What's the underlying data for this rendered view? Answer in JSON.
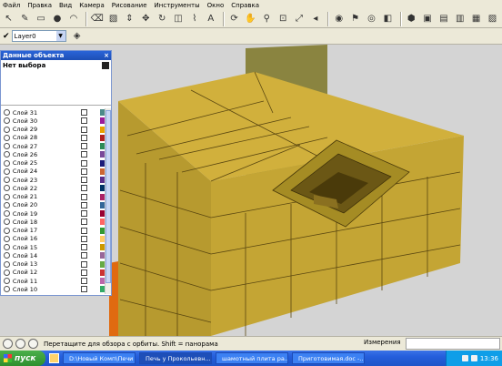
{
  "menu": [
    "Файл",
    "Правка",
    "Вид",
    "Камера",
    "Рисование",
    "Инструменты",
    "Окно",
    "Справка"
  ],
  "toolbar": {
    "icons": [
      "select-icon",
      "pencil-icon",
      "rectangle-icon",
      "circle-icon",
      "arc-icon",
      "eraser-icon",
      "paint-icon",
      "push-pull-icon",
      "move-icon",
      "rotate-icon",
      "offset-icon",
      "tape-icon",
      "text-icon",
      "orbit-icon",
      "pan-icon",
      "zoom-icon",
      "zoom-window-icon",
      "zoom-extents-icon",
      "previous-icon",
      "camera-icon",
      "walk-icon",
      "look-icon",
      "section-icon",
      "iso-view-icon",
      "top-view-icon",
      "front-view-icon",
      "right-view-icon",
      "back-view-icon",
      "left-view-icon"
    ],
    "layer_value": "Layer0"
  },
  "panel": {
    "title": "Данные объекта",
    "close": "×",
    "selection": "Нет выбора",
    "layers": [
      {
        "name": "Слой 31",
        "color": "#4b8a8a"
      },
      {
        "name": "Слой 30",
        "color": "#9b1b9b"
      },
      {
        "name": "Слой 29",
        "color": "#e8a000"
      },
      {
        "name": "Слой 28",
        "color": "#b02020"
      },
      {
        "name": "Слой 27",
        "color": "#2e8b57"
      },
      {
        "name": "Слой 26",
        "color": "#7a4a9a"
      },
      {
        "name": "Слой 25",
        "color": "#1a1a7a"
      },
      {
        "name": "Слой 24",
        "color": "#cc6633"
      },
      {
        "name": "Слой 23",
        "color": "#5a2e8a"
      },
      {
        "name": "Слой 22",
        "color": "#003366"
      },
      {
        "name": "Слой 21",
        "color": "#aa2266"
      },
      {
        "name": "Слой 20",
        "color": "#336699"
      },
      {
        "name": "Слой 19",
        "color": "#990033"
      },
      {
        "name": "Слой 18",
        "color": "#ff6666"
      },
      {
        "name": "Слой 17",
        "color": "#339933"
      },
      {
        "name": "Слой 16",
        "color": "#ffcc66"
      },
      {
        "name": "Слой 15",
        "color": "#cc9900"
      },
      {
        "name": "Слой 14",
        "color": "#996699"
      },
      {
        "name": "Слой 13",
        "color": "#66aa44"
      },
      {
        "name": "Слой 12",
        "color": "#cc3333"
      },
      {
        "name": "Слой 11",
        "color": "#bb66aa"
      },
      {
        "name": "Слой 10",
        "color": "#33aa66"
      }
    ]
  },
  "status": {
    "text": "Перетащите для обзора с орбиты.  Shift = панорама",
    "measure_label": "Измерения"
  },
  "taskbar": {
    "start": "пуск",
    "tasks": [
      {
        "label": "D:\\Новый Комп\\Печи",
        "active": false
      },
      {
        "label": "Печь у Прокольевн...",
        "active": true
      },
      {
        "label": "шамотный плита ра...",
        "active": false
      },
      {
        "label": "Приготовимая.doc -...",
        "active": false
      }
    ],
    "clock": "13:36"
  },
  "colors": {
    "brick_top": "#c9a838",
    "brick_left": "#b79a2f",
    "brick_right": "#a88b24",
    "brick_dark": "#8a7020",
    "base_orange": "#e06a10",
    "wall": "#8a8440"
  }
}
